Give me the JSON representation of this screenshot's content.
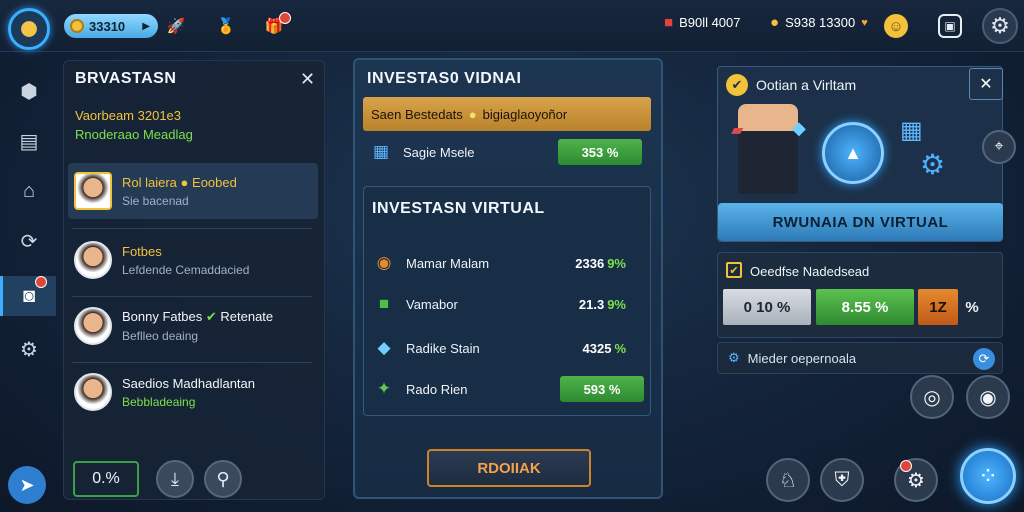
{
  "topbar": {
    "currency_value": "33310",
    "gold_value": "B90ll 4007",
    "gems_value": "S938 13300"
  },
  "left_panel": {
    "title": "BRVASTASN",
    "subtitle_line1": "Vaorbeam 3201e3",
    "subtitle_line2": "Rnoderaao Meadlag",
    "rows": [
      {
        "name": "Rol laiera",
        "tag": "Eoobed",
        "sub": "Sie bacenad"
      },
      {
        "name": "Fotbes",
        "tag": "",
        "sub": "Lefdende Cemaddacied"
      },
      {
        "name": "Bonny Fatbes",
        "tag": "Retenate",
        "sub": "Beflleo deaing"
      },
      {
        "name": "Saedios Madhadlantan",
        "tag": "",
        "sub": "Bebbladeaing"
      }
    ],
    "bottom_value": "0.%"
  },
  "center_panel": {
    "title": "INVESTAS0 VIDNAI",
    "gold_bar_text": "Saen Bestedats",
    "gold_bar_tag": "bigiaglaoyoñor",
    "summary_label": "Sagie Msele",
    "summary_value": "353 %",
    "section_title": "INVESTASN VIRTUAL",
    "rows": [
      {
        "icon": "snail-icon",
        "label": "Mamar Malam",
        "value": "2336",
        "pct": "9%"
      },
      {
        "icon": "cube-icon",
        "label": "Vamabor",
        "value": "21.3",
        "pct": "9%"
      },
      {
        "icon": "shard-icon",
        "label": "Radike Stain",
        "value": "4325",
        "pct": "%"
      },
      {
        "icon": "cash-icon",
        "label": "Rado Rien",
        "value": "593 %",
        "pct": ""
      }
    ],
    "button_label": "RDOIIAK"
  },
  "right_panel": {
    "title": "Ootian a Virltam",
    "button_label": "RWUNAIA DN VIRTUAL",
    "section_title": "Oeedfse Nadedsead",
    "option_1": "0 10 %",
    "option_2": "8.55 %",
    "option_3": "1Z",
    "option_suffix": "%",
    "info_text": "Mieder oepernoala"
  }
}
